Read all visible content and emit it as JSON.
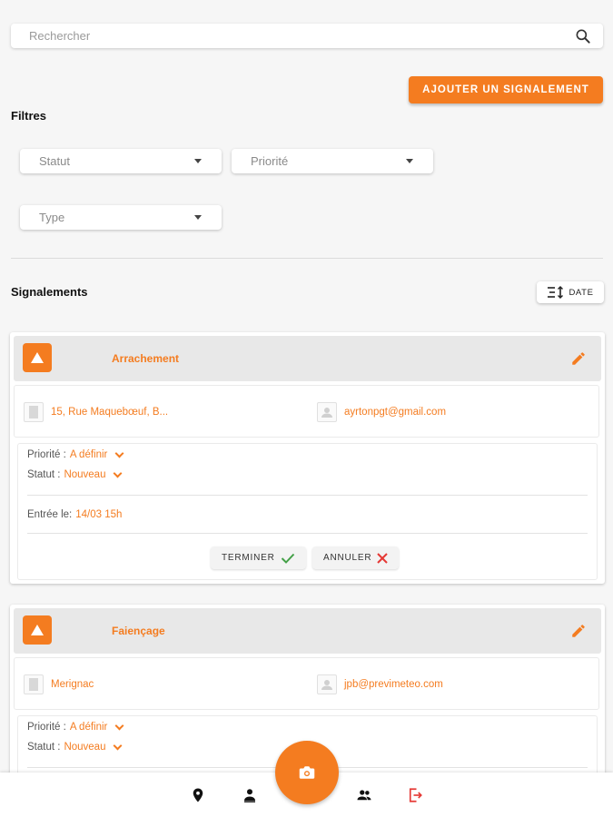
{
  "search": {
    "placeholder": "Rechercher"
  },
  "actions": {
    "add_label": "AJOUTER UN SIGNALEMENT"
  },
  "filters": {
    "title": "Filtres",
    "statut": "Statut",
    "priorite": "Priorité",
    "type": "Type"
  },
  "list": {
    "title": "Signalements",
    "sort_label": "DATE"
  },
  "reports": [
    {
      "title": "Arrachement",
      "address": "15, Rue Maquebœuf, B...",
      "email": "ayrtonpgt@gmail.com",
      "priority_label": "Priorité :",
      "priority_value": "A définir",
      "status_label": "Statut :",
      "status_value": "Nouveau",
      "entry_label": "Entrée le:",
      "entry_value": "14/03 15h",
      "finish_label": "TERMINER",
      "cancel_label": "ANNULER"
    },
    {
      "title": "Faiençage",
      "address": "Merignac",
      "email": "jpb@previmeteo.com",
      "priority_label": "Priorité :",
      "priority_value": "A définir",
      "status_label": "Statut :",
      "status_value": "Nouveau"
    }
  ],
  "colors": {
    "accent": "#f47c20",
    "logout": "#e53935"
  }
}
